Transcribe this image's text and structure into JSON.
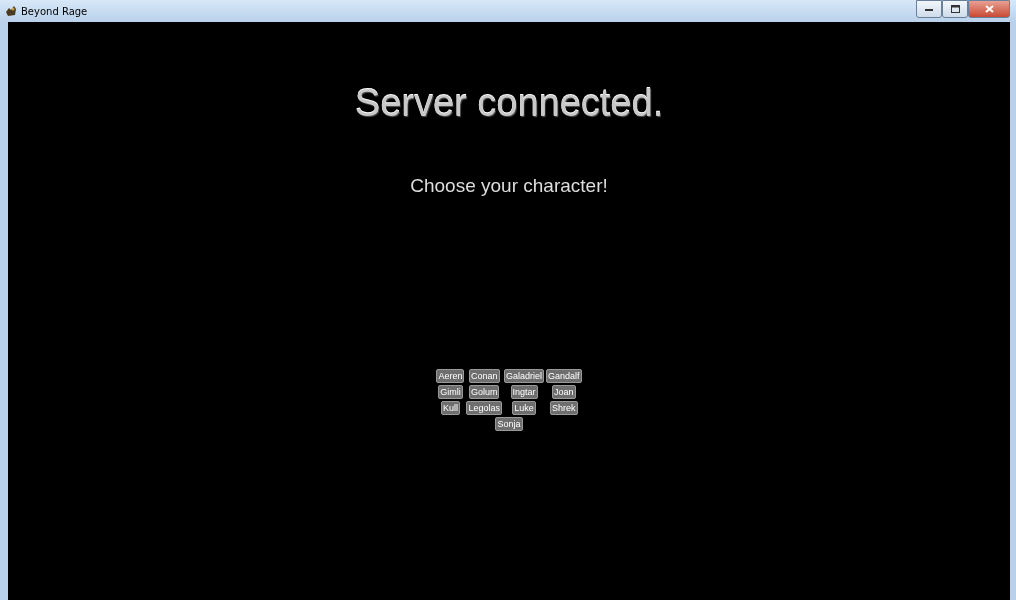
{
  "window": {
    "title": "Beyond Rage"
  },
  "heading": "Server connected.",
  "prompt": "Choose your character!",
  "characters": [
    "Aeren",
    "Conan",
    "Galadriel",
    "Gandalf",
    "Gimli",
    "Golum",
    "Ingtar",
    "Joan",
    "Kull",
    "Legolas",
    "Luke",
    "Shrek",
    "Sonja"
  ]
}
